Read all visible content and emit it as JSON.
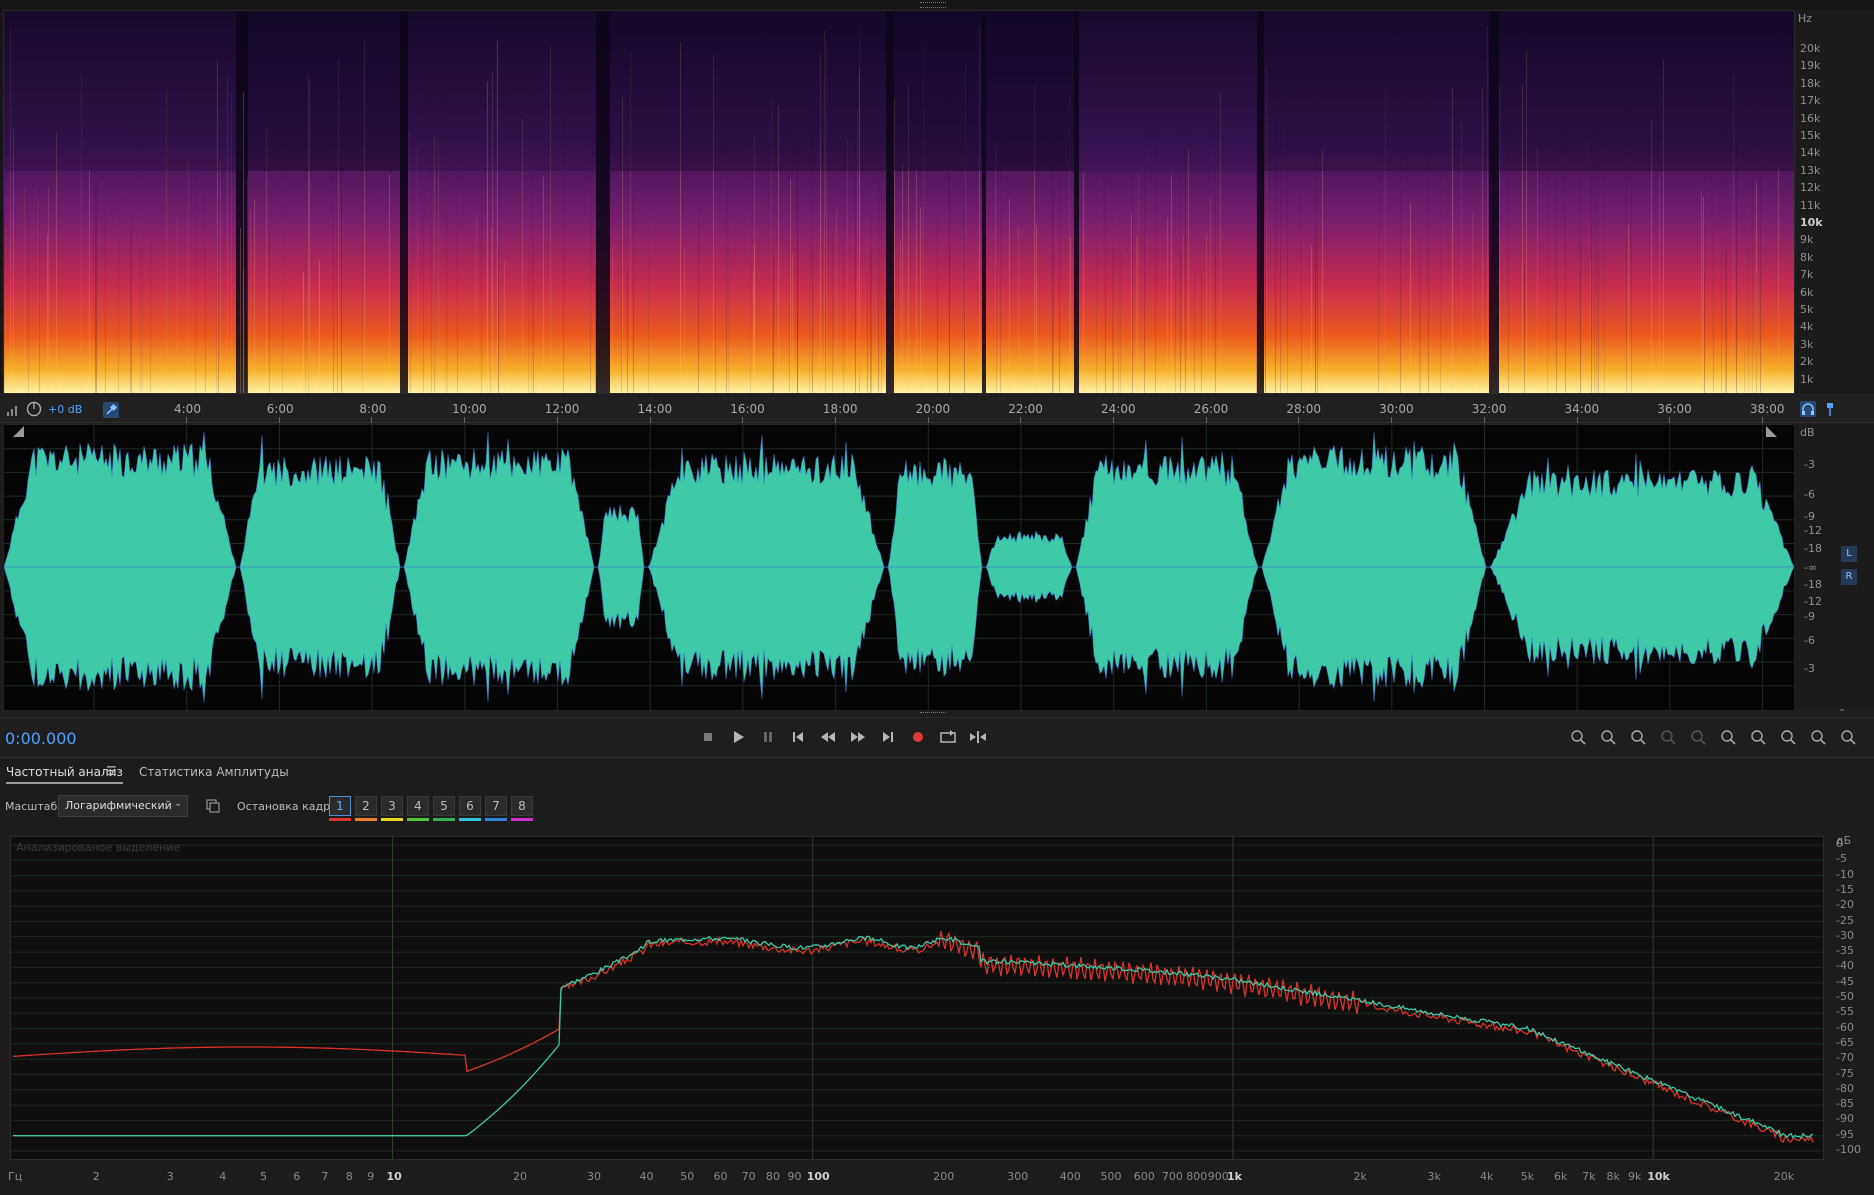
{
  "spectral": {
    "hz_unit": "Hz",
    "hz_labels": [
      "20k",
      "19k",
      "18k",
      "17k",
      "16k",
      "15k",
      "14k",
      "13k",
      "12k",
      "11k",
      "10k",
      "9k",
      "8k",
      "7k",
      "6k",
      "5k",
      "4k",
      "3k",
      "2k",
      "1k"
    ]
  },
  "timeline": {
    "gain": "+0 dB",
    "labels": [
      "4:00",
      "6:00",
      "8:00",
      "10:00",
      "12:00",
      "14:00",
      "16:00",
      "18:00",
      "20:00",
      "22:00",
      "24:00",
      "26:00",
      "28:00",
      "30:00",
      "32:00",
      "34:00",
      "36:00",
      "38:00"
    ]
  },
  "waveform": {
    "db_unit": "dB",
    "db_labels": [
      "-3",
      "-6",
      "-9",
      "-12",
      "-18",
      "-∞",
      "-18",
      "-12",
      "-9",
      "-6",
      "-3"
    ],
    "channel_left": "L",
    "channel_right": "R",
    "color": "#3ec9a7"
  },
  "transport": {
    "time": "0:00.000",
    "buttons": [
      "stop",
      "play",
      "pause",
      "skip-back",
      "rewind",
      "fast-forward",
      "skip-forward",
      "record",
      "loop",
      "skip-selection"
    ]
  },
  "analysis": {
    "tab_active": "Частотный анализ",
    "tab_other": "Статистика Амплитуды",
    "scale_label": "Масштаб:",
    "scale_value": "Логарифмический",
    "freeze_label": "Остановка кадра:",
    "frames": [
      {
        "n": "1",
        "color": "#e03030"
      },
      {
        "n": "2",
        "color": "#f08020"
      },
      {
        "n": "3",
        "color": "#e8d820"
      },
      {
        "n": "4",
        "color": "#50c830"
      },
      {
        "n": "5",
        "color": "#30b050"
      },
      {
        "n": "6",
        "color": "#30c8d8"
      },
      {
        "n": "7",
        "color": "#3080e0"
      },
      {
        "n": "8",
        "color": "#d030d0"
      }
    ],
    "overlay_text": "Анализированое выделение",
    "x_unit": "Гц",
    "y_unit": "дБ",
    "x_labels": [
      "2",
      "3",
      "4",
      "5",
      "6",
      "7",
      "8",
      "9",
      "10",
      "20",
      "30",
      "40",
      "50",
      "60",
      "70",
      "80",
      "90",
      "100",
      "200",
      "300",
      "400",
      "500",
      "600",
      "700",
      "800",
      "900",
      "1k",
      "2k",
      "3k",
      "4k",
      "5k",
      "6k",
      "7k",
      "8k",
      "9k",
      "10k",
      "20k"
    ],
    "y_labels": [
      "0",
      "-5",
      "-10",
      "-15",
      "-20",
      "-25",
      "-30",
      "-35",
      "-40",
      "-45",
      "-50",
      "-55",
      "-60",
      "-65",
      "-70",
      "-75",
      "-80",
      "-85",
      "-90",
      "-95",
      "-100"
    ],
    "colors": {
      "left": "#3ec9a7",
      "right": "#d8342a"
    }
  }
}
